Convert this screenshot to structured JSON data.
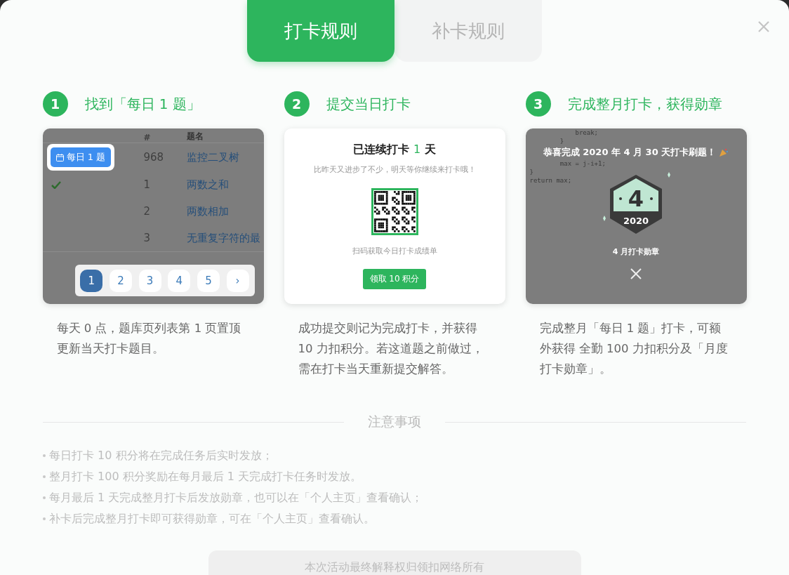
{
  "tabs": [
    {
      "label": "打卡规则",
      "selected": true
    },
    {
      "label": "补卡规则",
      "selected": false
    }
  ],
  "steps": [
    {
      "kind": "problem-list",
      "number": "1",
      "title": "找到「每日 1 题」",
      "description": "每天 0 点，题库页列表第 1 页置顶更新当天打卡题目。",
      "preview": {
        "columns": [
          "#",
          "题名"
        ],
        "daily_badge": "每日 1 题",
        "rows": [
          {
            "number": "968",
            "title": "监控二叉树",
            "solved": false
          },
          {
            "number": "1",
            "title": "两数之和",
            "solved": true
          },
          {
            "number": "2",
            "title": "两数相加",
            "solved": false
          },
          {
            "number": "3",
            "title": "无重复字符的最",
            "solved": false
          }
        ],
        "pages": [
          {
            "label": "1",
            "selected": true
          },
          {
            "label": "2",
            "selected": false
          },
          {
            "label": "3",
            "selected": false
          },
          {
            "label": "4",
            "selected": false
          },
          {
            "label": "5",
            "selected": false
          },
          {
            "label": "›",
            "selected": false
          }
        ]
      }
    },
    {
      "kind": "checkin",
      "number": "2",
      "title": "提交当日打卡",
      "description": "成功提交则记为完成打卡，并获得 10 力扣积分。若这道题之前做过，需在打卡当天重新提交解答。",
      "preview": {
        "headline": "已连续打卡 **1** 天",
        "subtitle": "比昨天又进步了不少，明天等你继续来打卡哦！",
        "qr_caption": "扫码获取今日打卡成绩单",
        "button": "领取 10 积分"
      }
    },
    {
      "kind": "medal",
      "number": "3",
      "title": "完成整月打卡，获得勋章",
      "description": "完成整月「每日 1 题」打卡，可额外获得 全勤 100 力扣积分及「月度打卡勋章」。",
      "preview": {
        "code_lines": [
          "            break;",
          "        }",
          "        max = j-i+1;",
          "}",
          "return max;"
        ],
        "congrats": "恭喜完成 2020 年 4 月 30 天打卡刷题！",
        "medal_number": "4",
        "medal_year": "2020",
        "medal_caption": "4 月打卡勋章"
      }
    }
  ],
  "notes": {
    "title": "注意事项",
    "items": [
      "每日打卡 10 积分将在完成任务后实时发放；",
      "整月打卡 100 积分奖励在每月最后 1 天完成打卡任务时发放。",
      "每月最后 1 天完成整月打卡后发放勋章，也可以在「个人主页」查看确认；",
      "补卡后完成整月打卡即可获得勋章，可在「个人主页」查看确认。"
    ]
  },
  "footer": "本次活动最终解释权归领扣网络所有"
}
